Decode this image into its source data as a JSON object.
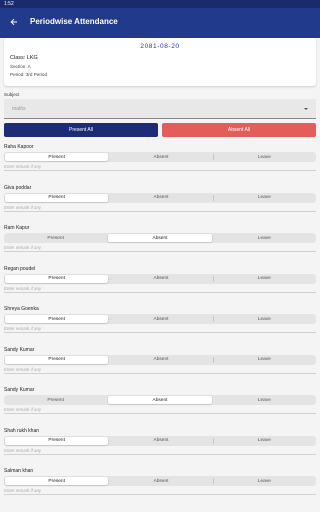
{
  "status_bar": {
    "time": "1:52"
  },
  "app_bar": {
    "title": "Periodwise Attendance"
  },
  "info": {
    "date": "2081-08-20",
    "class": "Class: LKG",
    "section": "Section: A",
    "period": "Period: 3rd Period"
  },
  "subject": {
    "label": "Subject",
    "value": "maths"
  },
  "bulk_actions": {
    "present_all": "Present All",
    "absent_all": "Absent All"
  },
  "options": {
    "present": "Present",
    "absent": "Absent",
    "leave": "Leave"
  },
  "remark_placeholder": "Enter remark if any",
  "students": [
    {
      "name": "Raha Kapoor",
      "status": "Present"
    },
    {
      "name": "Giva poddar",
      "status": "Present"
    },
    {
      "name": "Ram Kapur",
      "status": "Absent"
    },
    {
      "name": "Regan poudel",
      "status": "Present"
    },
    {
      "name": "Shreya Goenka",
      "status": "Present"
    },
    {
      "name": "Sandy Kumar",
      "status": "Present"
    },
    {
      "name": "Sandy Kumar",
      "status": "Absent"
    },
    {
      "name": "Shah rukh khan",
      "status": "Present"
    },
    {
      "name": "Salman khan",
      "status": "Present"
    }
  ],
  "colors": {
    "primary": "#223a8c",
    "present_all": "#1e2c78",
    "absent_all": "#e35d5d"
  }
}
